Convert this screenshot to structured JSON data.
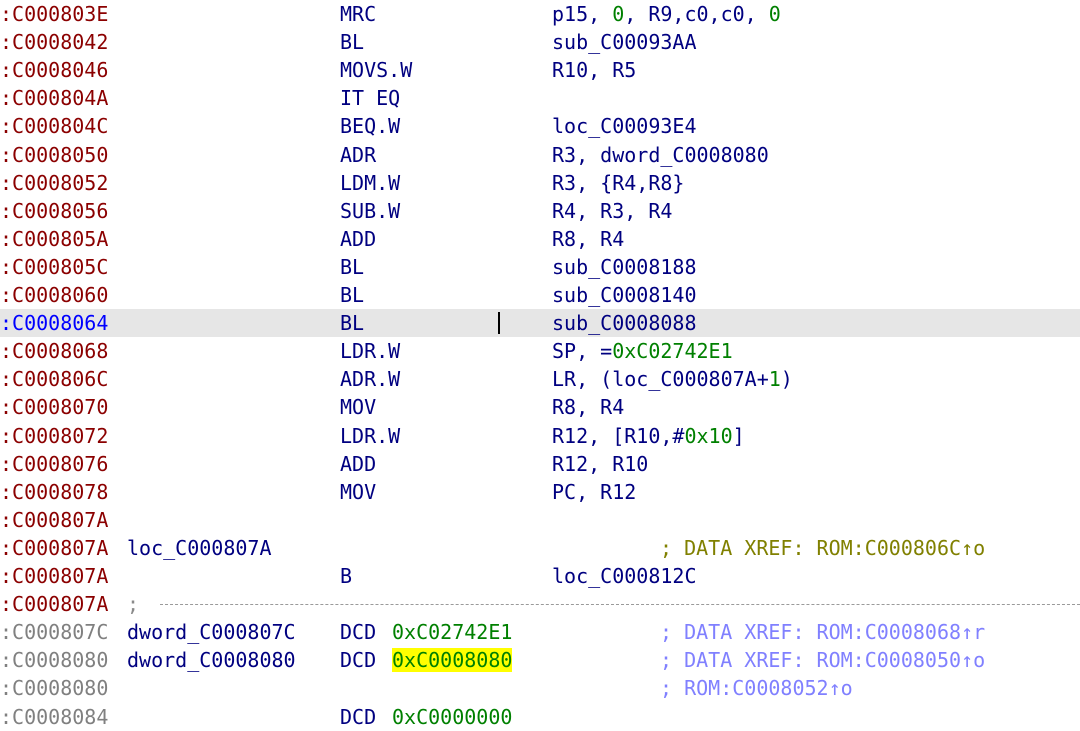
{
  "colors": {
    "addr_code": "#8b0000",
    "addr_selected": "#0000ff",
    "addr_data": "#808080",
    "text": "#000080",
    "number": "#008000",
    "comment_code": "#808000",
    "comment_data": "#8080ff",
    "highlight_row": "#e6e6e6",
    "highlight_token": "#ffff00"
  },
  "lines": [
    {
      "addr": ":C000803E",
      "mnemonic": "MRC",
      "operands": [
        {
          "t": "p15, "
        },
        {
          "t": "0",
          "c": "number"
        },
        {
          "t": ", R9,c0,c0, "
        },
        {
          "t": "0",
          "c": "number"
        }
      ]
    },
    {
      "addr": ":C0008042",
      "mnemonic": "BL",
      "operands": [
        {
          "t": "sub_C00093AA"
        }
      ]
    },
    {
      "addr": ":C0008046",
      "mnemonic": "MOVS.W",
      "operands": [
        {
          "t": "R10, R5"
        }
      ]
    },
    {
      "addr": ":C000804A",
      "mnemonic": "IT EQ",
      "operands": []
    },
    {
      "addr": ":C000804C",
      "mnemonic": "BEQ.W",
      "operands": [
        {
          "t": "loc_C00093E4"
        }
      ]
    },
    {
      "addr": ":C0008050",
      "mnemonic": "ADR",
      "operands": [
        {
          "t": "R3, dword_C0008080"
        }
      ]
    },
    {
      "addr": ":C0008052",
      "mnemonic": "LDM.W",
      "operands": [
        {
          "t": "R3, {R4,R8}"
        }
      ]
    },
    {
      "addr": ":C0008056",
      "mnemonic": "SUB.W",
      "operands": [
        {
          "t": "R4, R3, R4"
        }
      ]
    },
    {
      "addr": ":C000805A",
      "mnemonic": "ADD",
      "operands": [
        {
          "t": "R8, R4"
        }
      ]
    },
    {
      "addr": ":C000805C",
      "mnemonic": "BL",
      "operands": [
        {
          "t": "sub_C0008188"
        }
      ]
    },
    {
      "addr": ":C0008060",
      "mnemonic": "BL",
      "operands": [
        {
          "t": "sub_C0008140"
        }
      ]
    },
    {
      "addr": ":C0008064",
      "mnemonic": "BL",
      "operands": [
        {
          "t": "sub_C0008088"
        }
      ],
      "selected": true
    },
    {
      "addr": ":C0008068",
      "mnemonic": "LDR.W",
      "operands": [
        {
          "t": "SP, ="
        },
        {
          "t": "0xC02742E1",
          "c": "number"
        }
      ]
    },
    {
      "addr": ":C000806C",
      "mnemonic": "ADR.W",
      "operands": [
        {
          "t": "LR, (loc_C000807A+"
        },
        {
          "t": "1",
          "c": "number"
        },
        {
          "t": ")"
        }
      ]
    },
    {
      "addr": ":C0008070",
      "mnemonic": "MOV",
      "operands": [
        {
          "t": "R8, R4"
        }
      ]
    },
    {
      "addr": ":C0008072",
      "mnemonic": "LDR.W",
      "operands": [
        {
          "t": "R12, [R10,#"
        },
        {
          "t": "0x10",
          "c": "number"
        },
        {
          "t": "]"
        }
      ]
    },
    {
      "addr": ":C0008076",
      "mnemonic": "ADD",
      "operands": [
        {
          "t": "R12, R10"
        }
      ]
    },
    {
      "addr": ":C0008078",
      "mnemonic": "MOV",
      "operands": [
        {
          "t": "PC, R12"
        }
      ]
    },
    {
      "addr": ":C000807A",
      "operands": []
    },
    {
      "addr": ":C000807A",
      "label": "loc_C000807A",
      "comment": "; DATA XREF: ROM:C000806C↑o",
      "comment_type": "code",
      "operands": []
    },
    {
      "addr": ":C000807A",
      "mnemonic": "B",
      "operands": [
        {
          "t": "loc_C000812C"
        }
      ]
    },
    {
      "addr": ":C000807A",
      "separator": ";",
      "operands": []
    },
    {
      "addr": ":C000807C",
      "addr_type": "data",
      "label": "dword_C000807C",
      "mnemonic": "DCD",
      "mnemonic_offset": "data",
      "operands": [
        {
          "t": "0xC02742E1",
          "c": "number"
        }
      ],
      "comment": "; DATA XREF: ROM:C0008068↑r",
      "comment_type": "data"
    },
    {
      "addr": ":C0008080",
      "addr_type": "data",
      "label": "dword_C0008080",
      "mnemonic": "DCD",
      "mnemonic_offset": "data",
      "operands": [
        {
          "t": "0xC0008080",
          "c": "number",
          "hl": true
        }
      ],
      "comment": "; DATA XREF: ROM:C0008050↑o",
      "comment_type": "data"
    },
    {
      "addr": ":C0008080",
      "addr_type": "data",
      "comment": "; ROM:C0008052↑o",
      "comment_type": "data",
      "operands": []
    },
    {
      "addr": ":C0008084",
      "addr_type": "data",
      "mnemonic": "DCD",
      "mnemonic_offset": "data",
      "operands": [
        {
          "t": "0xC0000000",
          "c": "number"
        }
      ]
    }
  ]
}
